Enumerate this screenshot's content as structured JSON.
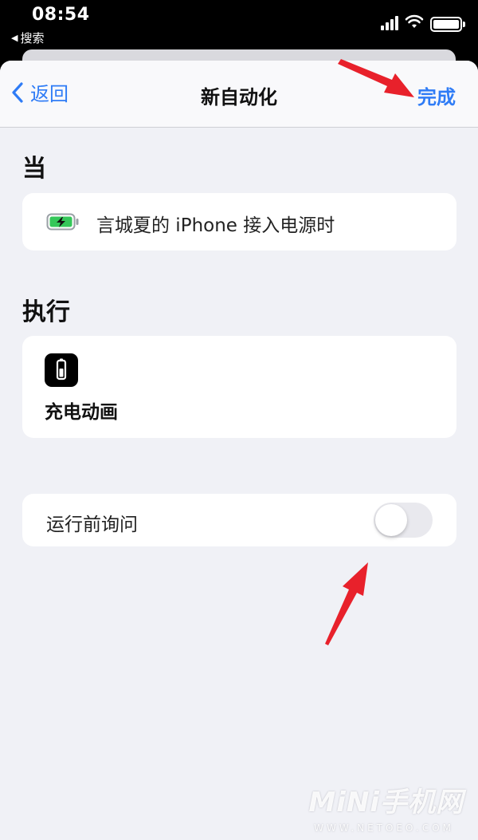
{
  "status_bar": {
    "time": "08:54",
    "back_app": "搜索",
    "back_icon": "back-triangle-icon"
  },
  "nav": {
    "back_label": "返回",
    "title": "新自动化",
    "done_label": "完成"
  },
  "trigger_section": {
    "heading": "当",
    "item": "言城夏的 iPhone 接入电源时",
    "icon": "charging-battery-icon"
  },
  "action_section": {
    "heading": "执行",
    "item": "充电动画",
    "icon": "battery-app-icon"
  },
  "options": {
    "ask_before_running_label": "运行前询问",
    "ask_before_running_on": false
  },
  "watermark": {
    "logo_text": "MiNi手机网",
    "sub_text": "WWW.NETOEO.COM"
  },
  "colors": {
    "accent": "#2f7cf6",
    "annotation_arrow": "#e8212b",
    "sheet_background": "#f0f1f6",
    "charging_green": "#34c759"
  }
}
